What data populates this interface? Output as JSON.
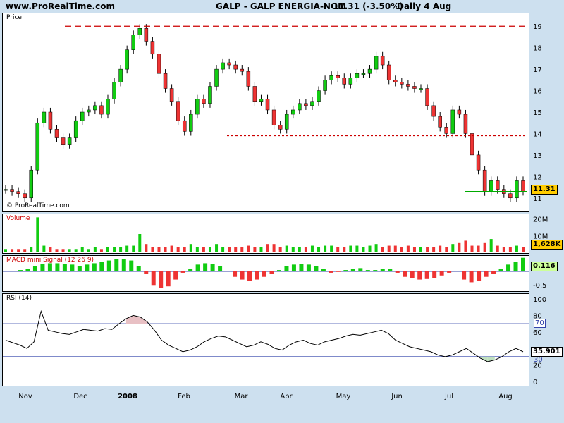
{
  "header": {
    "site": "www.ProRealTime.com",
    "title": "GALP - GALP ENERGIA-NOM",
    "quote": "11.31 (-3.50%)",
    "period": "Daily  4 Aug"
  },
  "panels": {
    "price": {
      "title": "Price",
      "watermark": "© ProRealTime.com",
      "last": "11.31",
      "last_color": "#ffcc00"
    },
    "volume": {
      "title": "Volume",
      "last": "1,628K",
      "last_color": "#ffcc00"
    },
    "macd": {
      "title": "MACD mini Signal (12 26 9)",
      "last": "0.116",
      "last_color": "#ccff99"
    },
    "rsi": {
      "title": "RSI (14)",
      "last": "35.901",
      "last_color": "#ffffff",
      "level_top": "70",
      "level_bottom": "30"
    }
  },
  "colors": {
    "up": "#11cc11",
    "down": "#ee3333",
    "text": "#000000",
    "resistance": "#cc0000",
    "support": "#00aa00"
  },
  "chart_data": [
    {
      "type": "candlestick",
      "title": "GALP - GALP ENERGIA-NOM",
      "ylabel": "Price",
      "ylim": [
        10.5,
        19.5
      ],
      "yticks": [
        11,
        12,
        13,
        14,
        15,
        16,
        17,
        18,
        19
      ],
      "x_tick_labels": [
        "Nov",
        "Dec",
        "2008",
        "Feb",
        "Mar",
        "Apr",
        "May",
        "Jun",
        "Jul",
        "Aug"
      ],
      "close_series": [
        11.4,
        11.3,
        11.2,
        11.0,
        12.3,
        14.5,
        15.0,
        14.2,
        13.8,
        13.5,
        13.8,
        14.6,
        15.0,
        15.1,
        15.3,
        14.9,
        15.6,
        16.4,
        17.0,
        17.9,
        18.6,
        18.9,
        18.3,
        17.7,
        16.8,
        16.1,
        15.5,
        14.6,
        14.1,
        14.9,
        15.6,
        15.4,
        16.2,
        17.0,
        17.3,
        17.2,
        17.0,
        16.9,
        16.2,
        15.5,
        15.6,
        15.1,
        14.4,
        14.2,
        14.9,
        15.1,
        15.4,
        15.3,
        15.5,
        16.0,
        16.5,
        16.7,
        16.6,
        16.3,
        16.6,
        16.8,
        16.8,
        17.0,
        17.6,
        17.2,
        16.5,
        16.4,
        16.3,
        16.2,
        16.1,
        16.1,
        15.3,
        14.8,
        14.3,
        14.0,
        15.1,
        14.9,
        14.0,
        13.0,
        12.3,
        11.3,
        11.8,
        11.4,
        11.2,
        11.0,
        11.8,
        11.31
      ],
      "resistance_lines": [
        19.0,
        13.9
      ],
      "support_line": 11.3
    },
    {
      "type": "bar",
      "title": "Volume",
      "ylim": [
        0,
        22
      ],
      "yticks": [
        "10M",
        "20M"
      ],
      "values": [
        2,
        2,
        2,
        2,
        3,
        21,
        4,
        3,
        2,
        2,
        2,
        2,
        3,
        2,
        3,
        2,
        3,
        3,
        3,
        4,
        4,
        11,
        5,
        3,
        3,
        3,
        4,
        3,
        3,
        5,
        3,
        3,
        3,
        5,
        3,
        3,
        3,
        3,
        4,
        3,
        3,
        5,
        5,
        3,
        4,
        3,
        3,
        3,
        4,
        3,
        4,
        4,
        3,
        3,
        4,
        4,
        3,
        4,
        5,
        3,
        4,
        4,
        3,
        4,
        3,
        3,
        3,
        3,
        4,
        3,
        5,
        6,
        7,
        4,
        4,
        6,
        8,
        4,
        3,
        3,
        4,
        3
      ]
    },
    {
      "type": "bar",
      "title": "MACD mini Signal (12 26 9)",
      "ylim": [
        -0.7,
        0.7
      ],
      "yticks": [
        "-0.5",
        "0.5"
      ],
      "values": [
        0.0,
        0.0,
        0.05,
        0.1,
        0.2,
        0.28,
        0.3,
        0.3,
        0.28,
        0.25,
        0.2,
        0.25,
        0.3,
        0.35,
        0.4,
        0.45,
        0.45,
        0.4,
        0.2,
        -0.1,
        -0.5,
        -0.62,
        -0.55,
        -0.3,
        -0.05,
        0.1,
        0.25,
        0.3,
        0.28,
        0.2,
        0.0,
        -0.2,
        -0.3,
        -0.35,
        -0.3,
        -0.2,
        -0.1,
        0.05,
        0.2,
        0.25,
        0.27,
        0.25,
        0.2,
        0.1,
        -0.05,
        -0.02,
        0.05,
        0.1,
        0.12,
        0.05,
        0.05,
        0.08,
        0.1,
        -0.05,
        -0.2,
        -0.25,
        -0.3,
        -0.28,
        -0.25,
        -0.15,
        -0.05,
        0.0,
        -0.3,
        -0.4,
        -0.35,
        -0.2,
        -0.1,
        0.1,
        0.25,
        0.35,
        0.5
      ]
    },
    {
      "type": "line",
      "title": "RSI (14)",
      "ylim": [
        0,
        100
      ],
      "yticks": [
        0,
        20,
        40,
        60,
        80,
        100
      ],
      "values": [
        50,
        47,
        44,
        40,
        48,
        85,
        62,
        60,
        58,
        57,
        60,
        63,
        62,
        61,
        64,
        63,
        70,
        76,
        80,
        78,
        72,
        62,
        50,
        44,
        40,
        36,
        38,
        42,
        48,
        52,
        55,
        54,
        50,
        46,
        42,
        44,
        48,
        45,
        40,
        38,
        44,
        48,
        50,
        46,
        44,
        48,
        50,
        52,
        55,
        57,
        56,
        58,
        60,
        62,
        58,
        50,
        46,
        42,
        40,
        38,
        36,
        32,
        30,
        32,
        36,
        40,
        34,
        28,
        24,
        26,
        30,
        36,
        40,
        36
      ]
    }
  ]
}
